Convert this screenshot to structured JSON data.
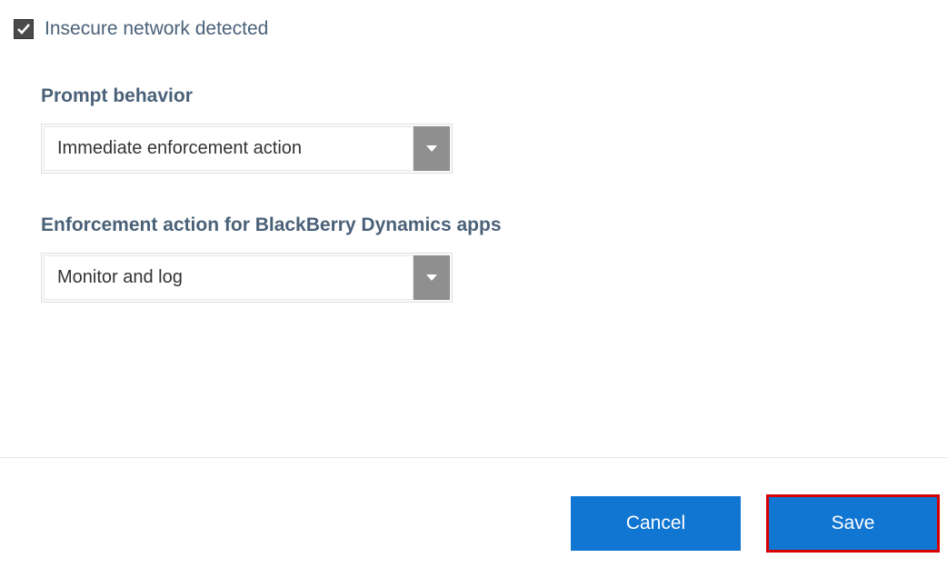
{
  "checkbox": {
    "label": "Insecure network detected",
    "checked": true
  },
  "promptBehavior": {
    "label": "Prompt behavior",
    "selected": "Immediate enforcement action"
  },
  "enforcementAction": {
    "label": "Enforcement action for BlackBerry Dynamics apps",
    "selected": "Monitor and log"
  },
  "buttons": {
    "cancel": "Cancel",
    "save": "Save"
  }
}
